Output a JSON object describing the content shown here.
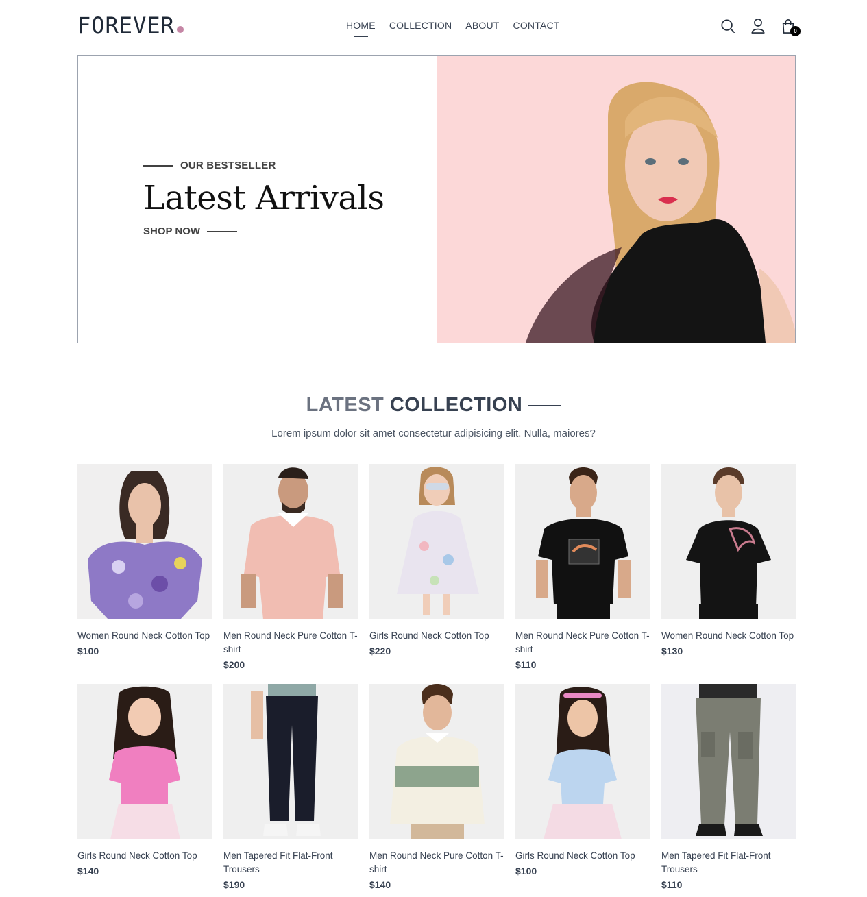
{
  "brand": {
    "name": "FOREVER",
    "accent": "#c586a5"
  },
  "nav": {
    "items": [
      {
        "label": "HOME",
        "active": true
      },
      {
        "label": "COLLECTION",
        "active": false
      },
      {
        "label": "ABOUT",
        "active": false
      },
      {
        "label": "CONTACT",
        "active": false
      }
    ],
    "icons": [
      "search-icon",
      "profile-icon",
      "cart-icon"
    ],
    "cart_count": "0"
  },
  "hero": {
    "eyebrow": "OUR BESTSELLER",
    "title": "Latest Arrivals",
    "cta": "SHOP NOW",
    "image_bg": "#fcd8d8"
  },
  "collection": {
    "title_light": "LATEST",
    "title_bold": "COLLECTION",
    "subtitle": "Lorem ipsum dolor sit amet consectetur adipisicing elit. Nulla, maiores?",
    "products": [
      {
        "name": "Women Round Neck Cotton Top",
        "price": "$100"
      },
      {
        "name": "Men Round Neck Pure Cotton T-shirt",
        "price": "$200"
      },
      {
        "name": "Girls Round Neck Cotton Top",
        "price": "$220"
      },
      {
        "name": "Men Round Neck Pure Cotton T-shirt",
        "price": "$110"
      },
      {
        "name": "Women Round Neck Cotton Top",
        "price": "$130"
      },
      {
        "name": "Girls Round Neck Cotton Top",
        "price": "$140"
      },
      {
        "name": "Men Tapered Fit Flat-Front Trousers",
        "price": "$190"
      },
      {
        "name": "Men Round Neck Pure Cotton T-shirt",
        "price": "$140"
      },
      {
        "name": "Girls Round Neck Cotton Top",
        "price": "$100"
      },
      {
        "name": "Men Tapered Fit Flat-Front Trousers",
        "price": "$110"
      }
    ]
  }
}
